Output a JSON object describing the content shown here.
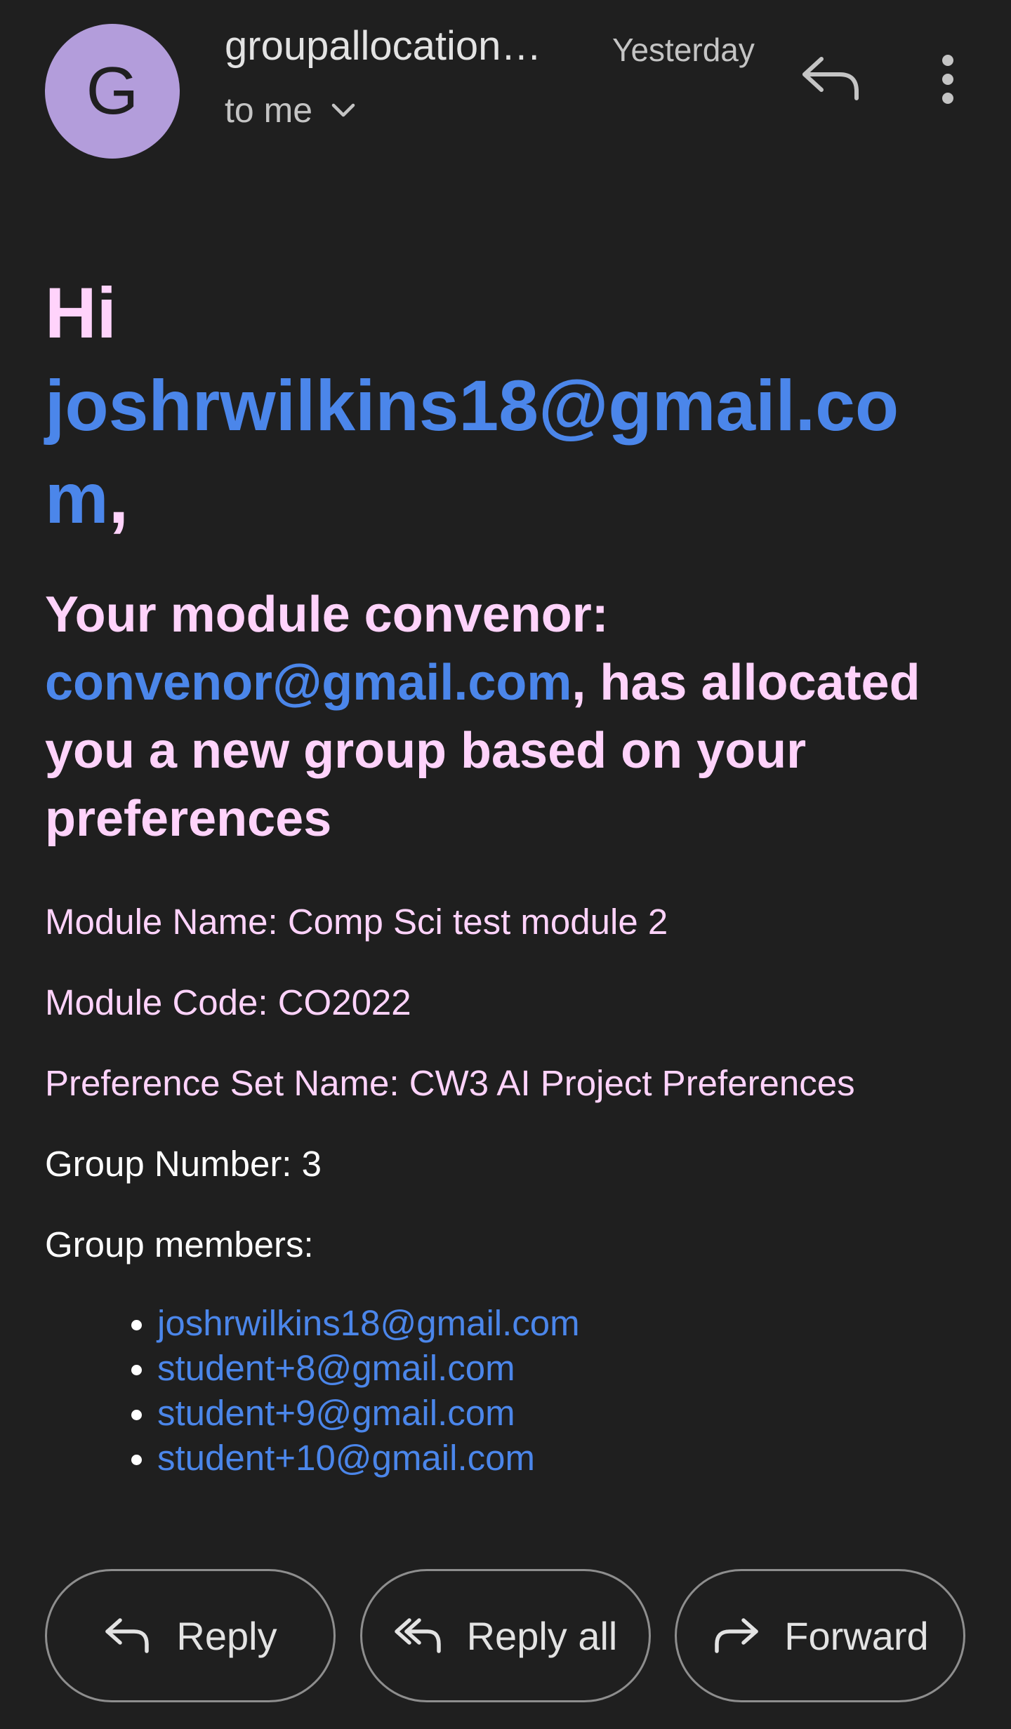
{
  "header": {
    "avatar_letter": "G",
    "sender": "groupallocation…",
    "date": "Yesterday",
    "recipient": "to me"
  },
  "body": {
    "greeting_hi": "Hi",
    "greeting_email": "joshrwilkins18@gmail.com",
    "greeting_comma": ",",
    "convenor_prefix": "Your module convenor:",
    "convenor_email": "convenor@gmail.com",
    "convenor_suffix": ", has allocated you a new group based on your preferences",
    "fields": [
      {
        "label": "Module Name: Comp Sci test module 2"
      },
      {
        "label": "Module Code: CO2022"
      },
      {
        "label": "Preference Set Name: CW3 AI Project Preferences"
      },
      {
        "label": "Group Number: 3"
      },
      {
        "label": "Group members:"
      }
    ],
    "members": [
      "joshrwilkins18@gmail.com",
      "student+8@gmail.com",
      "student+9@gmail.com",
      "student+10@gmail.com"
    ]
  },
  "actions": {
    "reply": "Reply",
    "reply_all": "Reply all",
    "forward": "Forward"
  }
}
